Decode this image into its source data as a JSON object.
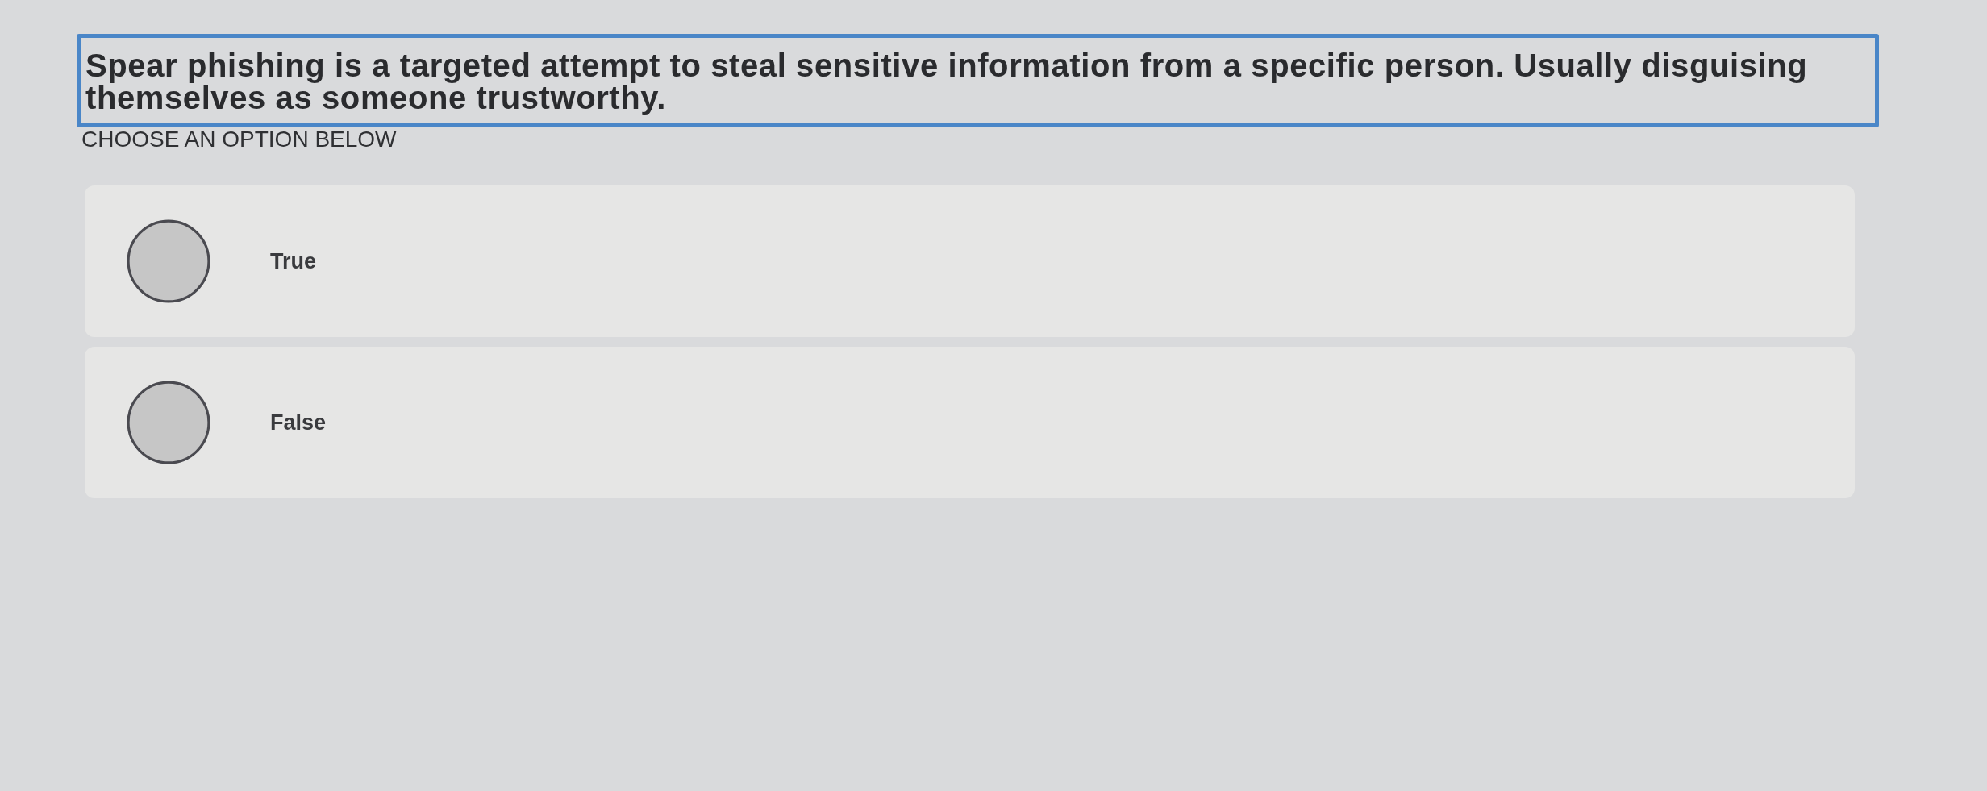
{
  "question": {
    "text": "Spear phishing is a targeted attempt to steal sensitive information from a specific person. Usually disguising themselves as someone trustworthy.",
    "instruction": "CHOOSE AN OPTION BELOW"
  },
  "options": [
    {
      "label": "True",
      "selected": false
    },
    {
      "label": "False",
      "selected": false
    }
  ]
}
